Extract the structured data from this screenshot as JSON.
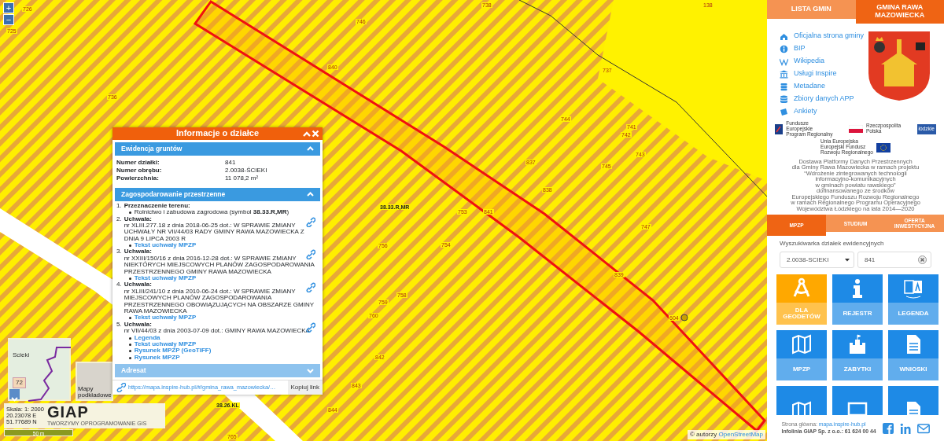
{
  "map": {
    "zoom_in": "+",
    "zoom_out": "−",
    "labels": [
      "726",
      "725",
      "746",
      "738",
      "138",
      "840",
      "736",
      "737",
      "744",
      "741",
      "742",
      "743",
      "745",
      "837",
      "838",
      "38.33.R,MR",
      "753",
      "841",
      "756",
      "754",
      "747",
      "839",
      "759",
      "758",
      "760",
      "842",
      "843",
      "844",
      "38.26.KL",
      "765",
      "604"
    ],
    "attribution": {
      "prefix": "© autorzy",
      "link": "OpenStreetMap"
    }
  },
  "popup": {
    "title": "Informacje o działce",
    "sections": [
      {
        "kind": "fields",
        "title": "Ewidencja gruntów",
        "expanded": true,
        "rows": [
          {
            "label": "Numer działki:",
            "value": "841"
          },
          {
            "label": "Numer obrębu:",
            "value": "2.0038-ŚCIEKI"
          },
          {
            "label": "Powierzchnia:",
            "value": "11 078,2 m²"
          }
        ]
      },
      {
        "kind": "list",
        "title": "Zagospodarowanie przestrzenne",
        "expanded": true,
        "items": [
          {
            "number": "1.",
            "title": "Przeznaczenie terenu:",
            "bullets": [
              "Rolnictwo i zabudowa zagrodowa (symbol **38.33.R,MR**)"
            ]
          },
          {
            "number": "2.",
            "title": "Uchwała:",
            "text": "nr XLIII.277.18 z dnia 2018-06-25 dot.: W SPRAWIE ZMIANY UCHWAŁY NR VII/44/03 RADY GMINY RAWA MAZOWIECKA Z DNIA 9 LIPCA 2003 R",
            "links": [
              "Tekst uchwały MPZP"
            ]
          },
          {
            "number": "3.",
            "title": "Uchwała:",
            "text": "nr XXIII/150/16 z dnia 2016-12-28 dot.: W SPRAWIE ZMIANY NIEKTÓRYCH MIEJSCOWYCH PLANÓW ZAGOSPODAROWANIA PRZESTRZENNEGO GMINY RAWA MAZOWIECKA",
            "links": [
              "Tekst uchwały MPZP"
            ]
          },
          {
            "number": "4.",
            "title": "Uchwała:",
            "text": "nr XLIII/241/10 z dnia 2010-06-24 dot.: W SPRAWIE ZMIANY MIEJSCOWYCH PLANÓW ZAGOSPODAROWANIA PRZESTRZENNEGO OBOWIĄZUJĄCYCH NA OBSZARZE GMINY RAWA MAZOWIECKA",
            "links": [
              "Tekst uchwały MPZP"
            ]
          },
          {
            "number": "5.",
            "title": "Uchwała:",
            "text": "nr VII/44/03 z dnia 2003-07-09 dot.: GMINY RAWA MAZOWIECKA",
            "links": [
              "Legenda",
              "Tekst uchwały MPZP",
              "Rysunek MPZP (GeoTIFF)",
              "Rysunek MPZP"
            ]
          }
        ]
      },
      {
        "title": "Adresat",
        "expanded": false
      }
    ],
    "url": "https://mapa.inspire-hub.pl/#/gmina_rawa_mazowiecka/…",
    "copy_button": "Kopiuj link"
  },
  "minimap": {
    "place": "Scieki",
    "road": "72",
    "basemap_label": "Mapy podkładowe"
  },
  "scale": {
    "lines": [
      "Skala: 1: 2000",
      "20.23078 E",
      "51.77689 N"
    ],
    "logo": "GIAP",
    "tagline": "TWORZYMY OPROGRAMOWANIE GIS",
    "bar": "50 m"
  },
  "panel": {
    "tabs": [
      {
        "label": "LISTA GMIN",
        "selected": false
      },
      {
        "label": "GMINA RAWA MAZOWIECKA",
        "selected": true
      }
    ],
    "links": [
      {
        "kind": "home",
        "label": "Oficjalna strona gminy"
      },
      {
        "kind": "info",
        "label": "BIP"
      },
      {
        "kind": "wiki",
        "label": "Wikipedia"
      },
      {
        "kind": "bank",
        "label": "Usługi Inspire"
      },
      {
        "kind": "stack",
        "label": "Metadane"
      },
      {
        "kind": "database",
        "label": "Zbiory danych APP"
      },
      {
        "kind": "book",
        "label": "Ankiety"
      }
    ],
    "logos": [
      {
        "kind": "fe",
        "lines": [
          "Fundusze",
          "Europejskie",
          "Program Regionalny"
        ]
      },
      {
        "kind": "flag",
        "lines": [
          "Rzeczpospolita",
          "Polska"
        ]
      },
      {
        "kind": "region",
        "lines": [
          "łódzkie"
        ]
      },
      {
        "kind": "eu",
        "lines": [
          "Unia Europejska",
          "Europejski Fundusz",
          "Rozwoju Regionalnego"
        ]
      }
    ],
    "description": [
      "Dostawa Platformy Danych Przestrzennych",
      "dla Gminy Rawa Mazowiecka w ramach projektu",
      "“Wdrożenie zintegrowanych technologii",
      "informacyjno-komunikacyjnych",
      "w gminach powiatu rawskiego”",
      "dofinansowanego ze środków",
      "Europejskiego Funduszu Rozwoju Regionalnego",
      "w ramach Regionalnego Programu Operacyjnego",
      "Województwa Łódzkiego na lata 2014—2020"
    ],
    "sub_tabs": [
      {
        "label": "MPZP",
        "selected": true
      },
      {
        "label": "STUDIUM",
        "selected": false
      },
      {
        "label": "OFERTA INWESTYCYJNA",
        "selected": false
      }
    ],
    "search": {
      "title": "Wyszukiwarka działek ewidencyjnych",
      "precinct": "2.0038-SCIEKI",
      "parcel": "841"
    },
    "tiles": [
      {
        "kind": "compass",
        "label": "DLA GEODETÓW",
        "color": "#ffa800"
      },
      {
        "kind": "info",
        "label": "REJESTR",
        "color": "#1e8ae6"
      },
      {
        "kind": "translate",
        "label": "LEGENDA",
        "color": "#1e8ae6"
      },
      {
        "kind": "map",
        "label": "MPZP",
        "color": "#1e8ae6"
      },
      {
        "kind": "castle",
        "label": "ZABYTKI",
        "color": "#1e8ae6"
      },
      {
        "kind": "document",
        "label": "WNIOSKI",
        "color": "#1e8ae6"
      },
      {
        "kind": "map",
        "color": "#1e8ae6"
      },
      {
        "kind": "monitor",
        "color": "#1e8ae6"
      },
      {
        "kind": "document",
        "color": "#1e8ae6"
      }
    ],
    "footer": {
      "site_label": "Strona główna:",
      "site_link": "mapa.inspire-hub.pl",
      "hotline": "Infolinia GIAP Sp. z o.o.: 61 624 00 44"
    }
  }
}
